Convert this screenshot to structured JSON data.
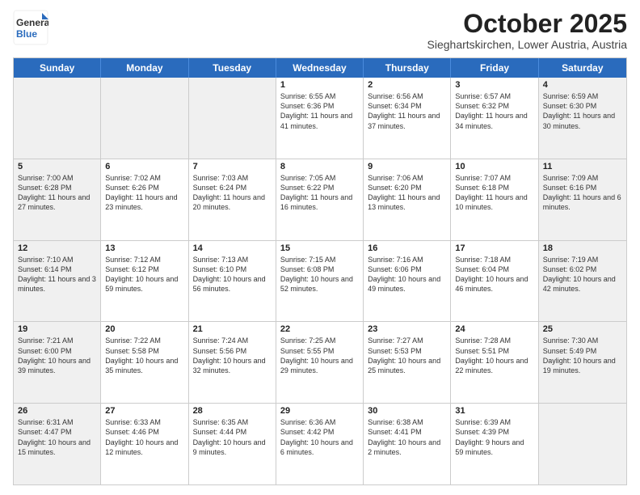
{
  "header": {
    "logo_general": "General",
    "logo_blue": "Blue",
    "month_title": "October 2025",
    "location": "Sieghartskirchen, Lower Austria, Austria"
  },
  "days_of_week": [
    "Sunday",
    "Monday",
    "Tuesday",
    "Wednesday",
    "Thursday",
    "Friday",
    "Saturday"
  ],
  "weeks": [
    [
      {
        "day": "",
        "text": "",
        "shaded": true
      },
      {
        "day": "",
        "text": "",
        "shaded": true
      },
      {
        "day": "",
        "text": "",
        "shaded": true
      },
      {
        "day": "1",
        "text": "Sunrise: 6:55 AM\nSunset: 6:36 PM\nDaylight: 11 hours\nand 41 minutes.",
        "shaded": false
      },
      {
        "day": "2",
        "text": "Sunrise: 6:56 AM\nSunset: 6:34 PM\nDaylight: 11 hours\nand 37 minutes.",
        "shaded": false
      },
      {
        "day": "3",
        "text": "Sunrise: 6:57 AM\nSunset: 6:32 PM\nDaylight: 11 hours\nand 34 minutes.",
        "shaded": false
      },
      {
        "day": "4",
        "text": "Sunrise: 6:59 AM\nSunset: 6:30 PM\nDaylight: 11 hours\nand 30 minutes.",
        "shaded": true
      }
    ],
    [
      {
        "day": "5",
        "text": "Sunrise: 7:00 AM\nSunset: 6:28 PM\nDaylight: 11 hours\nand 27 minutes.",
        "shaded": true
      },
      {
        "day": "6",
        "text": "Sunrise: 7:02 AM\nSunset: 6:26 PM\nDaylight: 11 hours\nand 23 minutes.",
        "shaded": false
      },
      {
        "day": "7",
        "text": "Sunrise: 7:03 AM\nSunset: 6:24 PM\nDaylight: 11 hours\nand 20 minutes.",
        "shaded": false
      },
      {
        "day": "8",
        "text": "Sunrise: 7:05 AM\nSunset: 6:22 PM\nDaylight: 11 hours\nand 16 minutes.",
        "shaded": false
      },
      {
        "day": "9",
        "text": "Sunrise: 7:06 AM\nSunset: 6:20 PM\nDaylight: 11 hours\nand 13 minutes.",
        "shaded": false
      },
      {
        "day": "10",
        "text": "Sunrise: 7:07 AM\nSunset: 6:18 PM\nDaylight: 11 hours\nand 10 minutes.",
        "shaded": false
      },
      {
        "day": "11",
        "text": "Sunrise: 7:09 AM\nSunset: 6:16 PM\nDaylight: 11 hours\nand 6 minutes.",
        "shaded": true
      }
    ],
    [
      {
        "day": "12",
        "text": "Sunrise: 7:10 AM\nSunset: 6:14 PM\nDaylight: 11 hours\nand 3 minutes.",
        "shaded": true
      },
      {
        "day": "13",
        "text": "Sunrise: 7:12 AM\nSunset: 6:12 PM\nDaylight: 10 hours\nand 59 minutes.",
        "shaded": false
      },
      {
        "day": "14",
        "text": "Sunrise: 7:13 AM\nSunset: 6:10 PM\nDaylight: 10 hours\nand 56 minutes.",
        "shaded": false
      },
      {
        "day": "15",
        "text": "Sunrise: 7:15 AM\nSunset: 6:08 PM\nDaylight: 10 hours\nand 52 minutes.",
        "shaded": false
      },
      {
        "day": "16",
        "text": "Sunrise: 7:16 AM\nSunset: 6:06 PM\nDaylight: 10 hours\nand 49 minutes.",
        "shaded": false
      },
      {
        "day": "17",
        "text": "Sunrise: 7:18 AM\nSunset: 6:04 PM\nDaylight: 10 hours\nand 46 minutes.",
        "shaded": false
      },
      {
        "day": "18",
        "text": "Sunrise: 7:19 AM\nSunset: 6:02 PM\nDaylight: 10 hours\nand 42 minutes.",
        "shaded": true
      }
    ],
    [
      {
        "day": "19",
        "text": "Sunrise: 7:21 AM\nSunset: 6:00 PM\nDaylight: 10 hours\nand 39 minutes.",
        "shaded": true
      },
      {
        "day": "20",
        "text": "Sunrise: 7:22 AM\nSunset: 5:58 PM\nDaylight: 10 hours\nand 35 minutes.",
        "shaded": false
      },
      {
        "day": "21",
        "text": "Sunrise: 7:24 AM\nSunset: 5:56 PM\nDaylight: 10 hours\nand 32 minutes.",
        "shaded": false
      },
      {
        "day": "22",
        "text": "Sunrise: 7:25 AM\nSunset: 5:55 PM\nDaylight: 10 hours\nand 29 minutes.",
        "shaded": false
      },
      {
        "day": "23",
        "text": "Sunrise: 7:27 AM\nSunset: 5:53 PM\nDaylight: 10 hours\nand 25 minutes.",
        "shaded": false
      },
      {
        "day": "24",
        "text": "Sunrise: 7:28 AM\nSunset: 5:51 PM\nDaylight: 10 hours\nand 22 minutes.",
        "shaded": false
      },
      {
        "day": "25",
        "text": "Sunrise: 7:30 AM\nSunset: 5:49 PM\nDaylight: 10 hours\nand 19 minutes.",
        "shaded": true
      }
    ],
    [
      {
        "day": "26",
        "text": "Sunrise: 6:31 AM\nSunset: 4:47 PM\nDaylight: 10 hours\nand 15 minutes.",
        "shaded": true
      },
      {
        "day": "27",
        "text": "Sunrise: 6:33 AM\nSunset: 4:46 PM\nDaylight: 10 hours\nand 12 minutes.",
        "shaded": false
      },
      {
        "day": "28",
        "text": "Sunrise: 6:35 AM\nSunset: 4:44 PM\nDaylight: 10 hours\nand 9 minutes.",
        "shaded": false
      },
      {
        "day": "29",
        "text": "Sunrise: 6:36 AM\nSunset: 4:42 PM\nDaylight: 10 hours\nand 6 minutes.",
        "shaded": false
      },
      {
        "day": "30",
        "text": "Sunrise: 6:38 AM\nSunset: 4:41 PM\nDaylight: 10 hours\nand 2 minutes.",
        "shaded": false
      },
      {
        "day": "31",
        "text": "Sunrise: 6:39 AM\nSunset: 4:39 PM\nDaylight: 9 hours\nand 59 minutes.",
        "shaded": false
      },
      {
        "day": "",
        "text": "",
        "shaded": true
      }
    ]
  ]
}
